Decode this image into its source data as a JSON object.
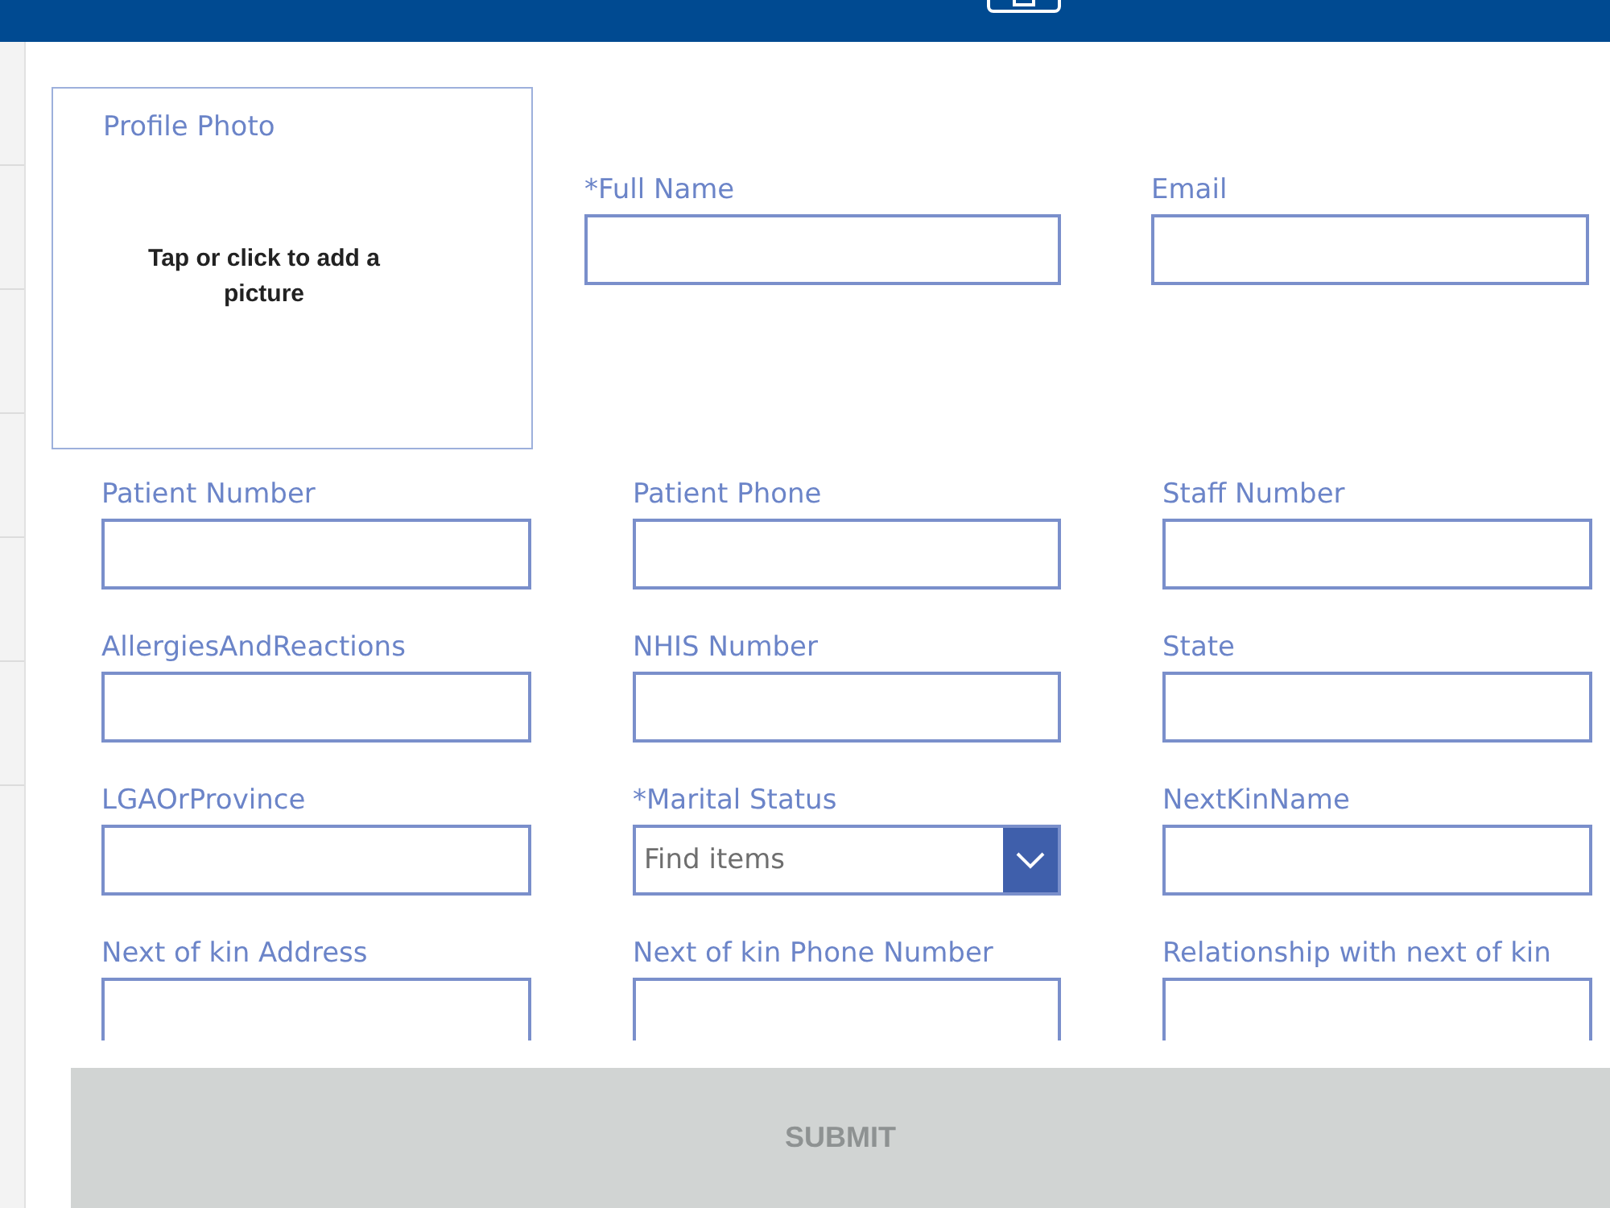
{
  "profile_photo": {
    "label": "Profile Photo",
    "hint": "Tap or click to add a picture"
  },
  "top_fields": [
    {
      "label": "*Full Name",
      "kind": "text"
    },
    {
      "label": "Email",
      "kind": "text"
    }
  ],
  "fields": [
    {
      "label": "Patient Number",
      "kind": "text"
    },
    {
      "label": "Patient Phone",
      "kind": "text"
    },
    {
      "label": "Staff Number",
      "kind": "text"
    },
    {
      "label": "AllergiesAndReactions",
      "kind": "text"
    },
    {
      "label": "NHIS Number",
      "kind": "text"
    },
    {
      "label": "State",
      "kind": "text"
    },
    {
      "label": "LGAOrProvince",
      "kind": "text"
    },
    {
      "label": "*Marital Status",
      "kind": "dropdown",
      "placeholder": "Find items"
    },
    {
      "label": "NextKinName",
      "kind": "text"
    },
    {
      "label": "Next of kin Address",
      "kind": "text"
    },
    {
      "label": "Next of kin Phone Number",
      "kind": "text"
    },
    {
      "label": "Relationship with next of kin",
      "kind": "text"
    }
  ],
  "submit": {
    "label": "SUBMIT",
    "disabled": true
  }
}
